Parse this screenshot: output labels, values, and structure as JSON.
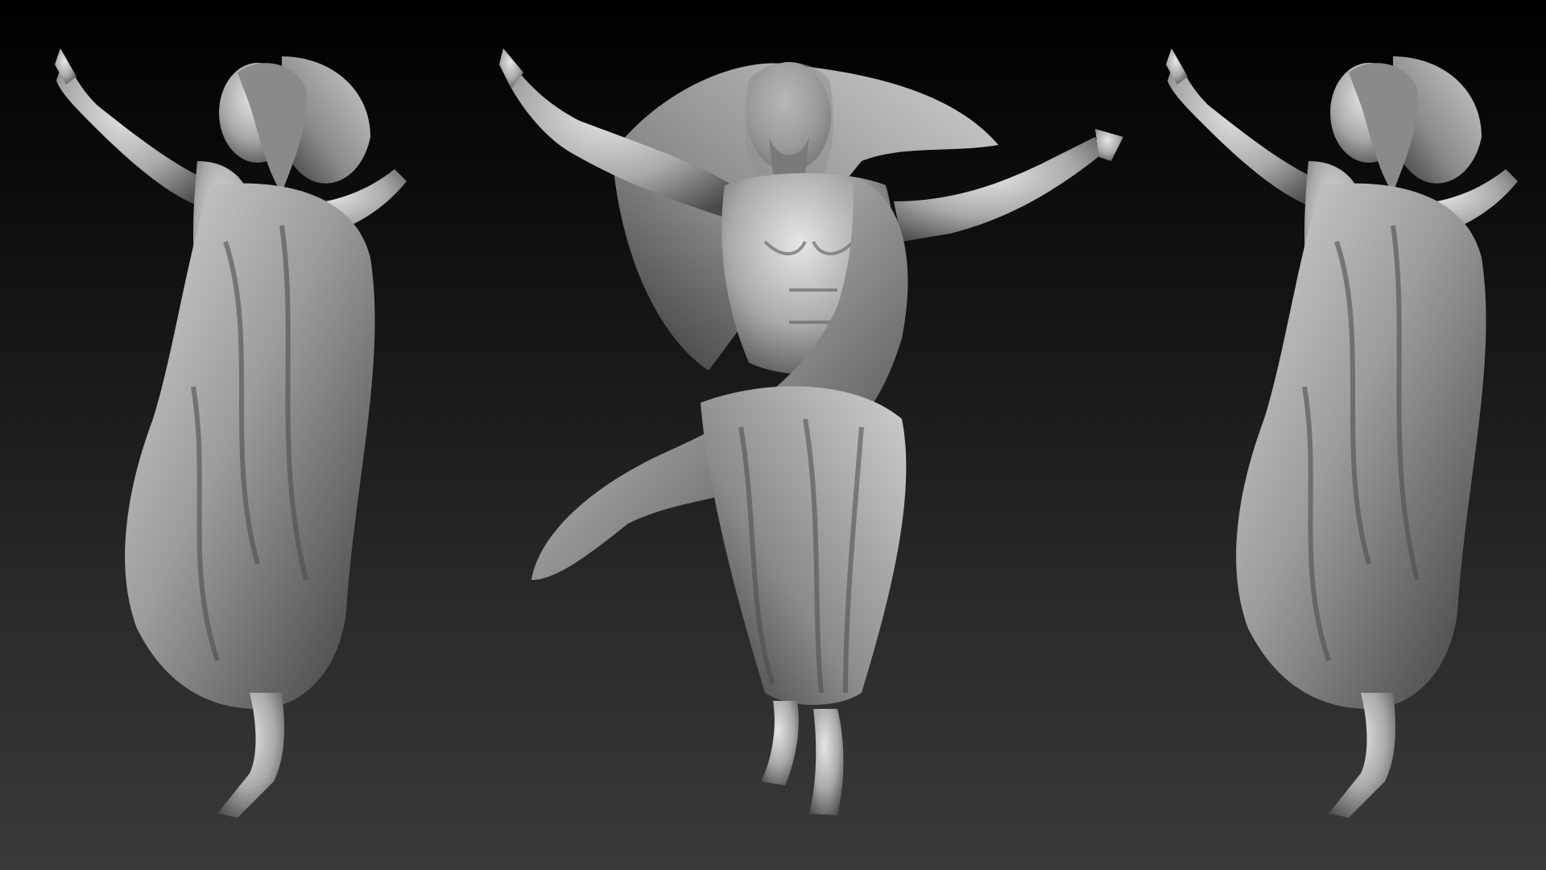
{
  "scene": {
    "background_top": "#000000",
    "background_bottom": "#3a3a3a",
    "material_color": "#a8a8a8",
    "views": [
      {
        "id": "left",
        "view": "side-left"
      },
      {
        "id": "center",
        "view": "front"
      },
      {
        "id": "right",
        "view": "side-left"
      }
    ]
  }
}
